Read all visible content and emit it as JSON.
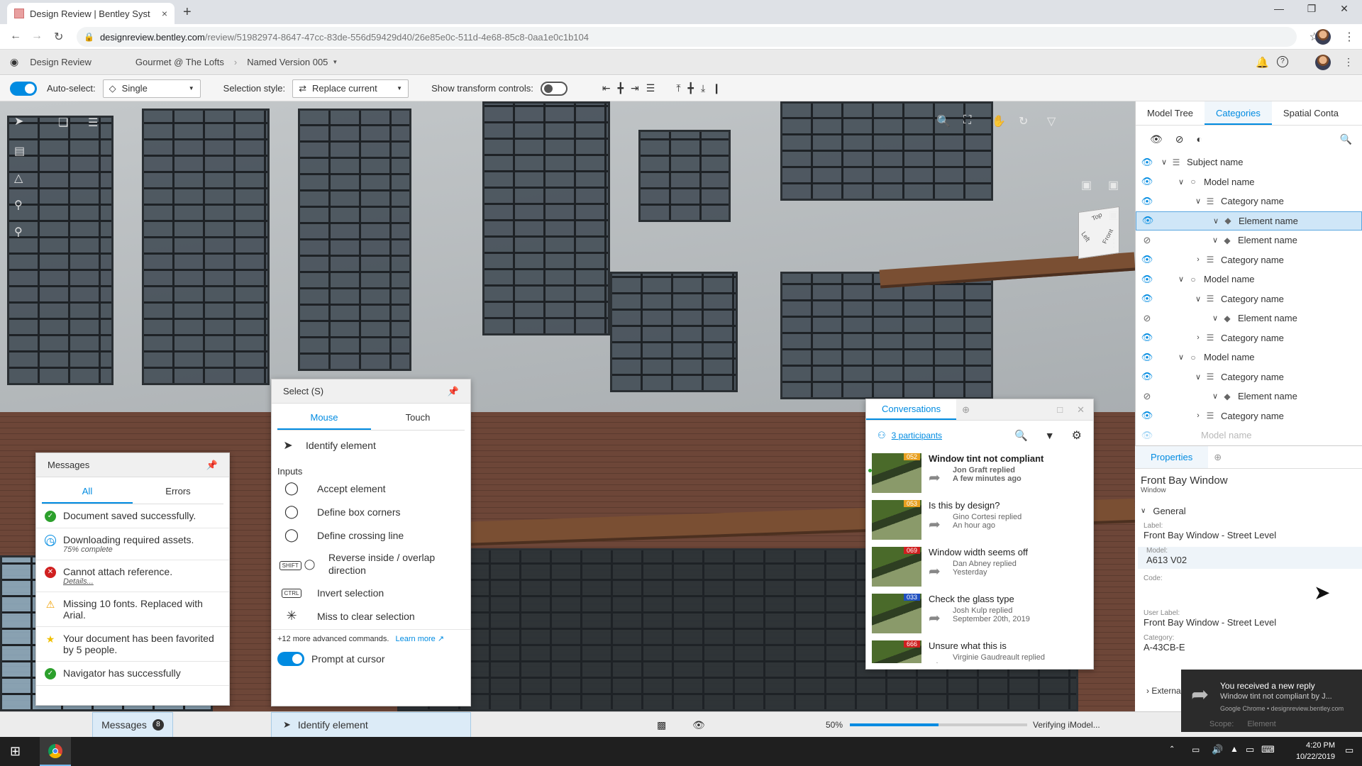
{
  "browser": {
    "tab_title": "Design Review | Bentley Syst",
    "tab_close": "×",
    "new_tab": "+",
    "url_host": "designreview.bentley.com",
    "url_path": "/review/51982974-8647-47cc-83de-556d59429d40/26e85e0c-511d-4e68-85c8-0aa1e0c1b104"
  },
  "app_header": {
    "app_name": "Design Review",
    "project": "Gourmet @ The Lofts",
    "version": "Named Version 005"
  },
  "toolbar": {
    "auto_select_label": "Auto-select:",
    "auto_select_value": "Single",
    "selection_style_label": "Selection style:",
    "selection_style_value": "Replace current",
    "transform_label": "Show transform controls:"
  },
  "right_panel": {
    "tabs": [
      "Model Tree",
      "Categories",
      "Spatial Conta"
    ],
    "active_tab": "Categories",
    "tree": [
      {
        "label": "Subject name",
        "level": 0,
        "visible": true,
        "expanded": true,
        "kind": "subject"
      },
      {
        "label": "Model name",
        "level": 1,
        "visible": true,
        "expanded": true,
        "kind": "model"
      },
      {
        "label": "Category name",
        "level": 2,
        "visible": true,
        "expanded": true,
        "kind": "category"
      },
      {
        "label": "Element name",
        "level": 3,
        "visible": true,
        "expanded": true,
        "kind": "element",
        "selected": true
      },
      {
        "label": "Element name",
        "level": 3,
        "visible": false,
        "expanded": true,
        "kind": "element"
      },
      {
        "label": "Category name",
        "level": 2,
        "visible": true,
        "expanded": false,
        "kind": "category"
      },
      {
        "label": "Model name",
        "level": 1,
        "visible": true,
        "expanded": true,
        "kind": "model"
      },
      {
        "label": "Category name",
        "level": 2,
        "visible": true,
        "expanded": true,
        "kind": "category"
      },
      {
        "label": "Element name",
        "level": 3,
        "visible": false,
        "expanded": true,
        "kind": "element"
      },
      {
        "label": "Category name",
        "level": 2,
        "visible": true,
        "expanded": false,
        "kind": "category"
      },
      {
        "label": "Model name",
        "level": 1,
        "visible": true,
        "expanded": true,
        "kind": "model"
      },
      {
        "label": "Category name",
        "level": 2,
        "visible": true,
        "expanded": true,
        "kind": "category"
      },
      {
        "label": "Element name",
        "level": 3,
        "visible": false,
        "expanded": true,
        "kind": "element"
      },
      {
        "label": "Category name",
        "level": 2,
        "visible": true,
        "expanded": false,
        "kind": "category"
      }
    ],
    "tree_partial": "Model name"
  },
  "properties": {
    "tab": "Properties",
    "title": "Front Bay Window",
    "subtitle": "Window",
    "section": "General",
    "fields": [
      {
        "label": "Label:",
        "value": "Front Bay Window - Street Level"
      },
      {
        "label": "Model:",
        "value": "A613 V02"
      },
      {
        "label": "Code:",
        "value": ""
      },
      {
        "label": "User Label:",
        "value": "Front Bay Window - Street Level"
      },
      {
        "label": "Category:",
        "value": "A-43CB-E"
      }
    ],
    "external": "Externa"
  },
  "messages_panel": {
    "title": "Messages",
    "tabs": [
      "All",
      "Errors"
    ],
    "items": [
      {
        "text": "Document saved successfully.",
        "sub": "",
        "status": "success"
      },
      {
        "text": "Downloading required assets.",
        "sub": "75% complete",
        "status": "info"
      },
      {
        "text": "Cannot attach reference.",
        "sub": "Details...",
        "status": "error"
      },
      {
        "text": "Missing 10 fonts. Replaced with Arial.",
        "sub": "",
        "status": "warning"
      },
      {
        "text": "Your document has been favorited by 5 people.",
        "sub": "",
        "status": "star"
      },
      {
        "text": "Navigator has successfully",
        "sub": "",
        "status": "success"
      }
    ]
  },
  "select_panel": {
    "title": "Select  (S)",
    "tabs": [
      "Mouse",
      "Touch"
    ],
    "identify": "Identify element",
    "inputs_heading": "Inputs",
    "commands": [
      {
        "key": "",
        "label": "Accept element"
      },
      {
        "key": "",
        "label": "Define box corners"
      },
      {
        "key": "",
        "label": "Define crossing line"
      },
      {
        "key": "SHIFT",
        "label": "Reverse inside / overlap direction"
      },
      {
        "key": "CTRL",
        "label": "Invert selection"
      },
      {
        "key": "",
        "label": "Miss to clear selection"
      }
    ],
    "more": "+12 more advanced commands.",
    "learn_more": "Learn more",
    "prompt_label": "Prompt at cursor"
  },
  "conversations": {
    "tab": "Conversations",
    "participants": "3 participants",
    "items": [
      {
        "badge": "052",
        "badge_color": "#e8a020",
        "title": "Window tint not compliant",
        "who": "Jon Graft replied",
        "when": "A few minutes ago",
        "unread": true
      },
      {
        "badge": "053",
        "badge_color": "#e8a020",
        "title": "Is this by design?",
        "who": "Gino Cortesi replied",
        "when": "An hour ago",
        "unread": false
      },
      {
        "badge": "069",
        "badge_color": "#d02020",
        "title": "Window width seems off",
        "who": "Dan Abney replied",
        "when": "Yesterday",
        "unread": false
      },
      {
        "badge": "033",
        "badge_color": "#2050c0",
        "title": "Check the glass type",
        "who": "Josh Kulp replied",
        "when": "September 20th, 2019",
        "unread": false
      },
      {
        "badge": "666",
        "badge_color": "#d02020",
        "title": "Unsure what this is",
        "who": "Virginie Gaudreault replied",
        "when": "",
        "unread": false
      }
    ]
  },
  "status_bar": {
    "messages_label": "Messages",
    "messages_count": "8",
    "tool_label": "Identify element",
    "progress_text": "50%",
    "progress_value": 0.5,
    "status_text": "Verifying iModel..."
  },
  "toast": {
    "title": "You received a new reply",
    "body": "Window tint not compliant by J...",
    "source": "Google Chrome • designreview.bentley.com",
    "scope_label": "Scope:",
    "scope_value": "Element"
  },
  "taskbar": {
    "time": "4:20 PM",
    "date": "10/22/2019"
  },
  "colors": {
    "accent": "#008be1",
    "success": "#2ca02c",
    "error": "#d02020",
    "warning": "#f0a000"
  }
}
